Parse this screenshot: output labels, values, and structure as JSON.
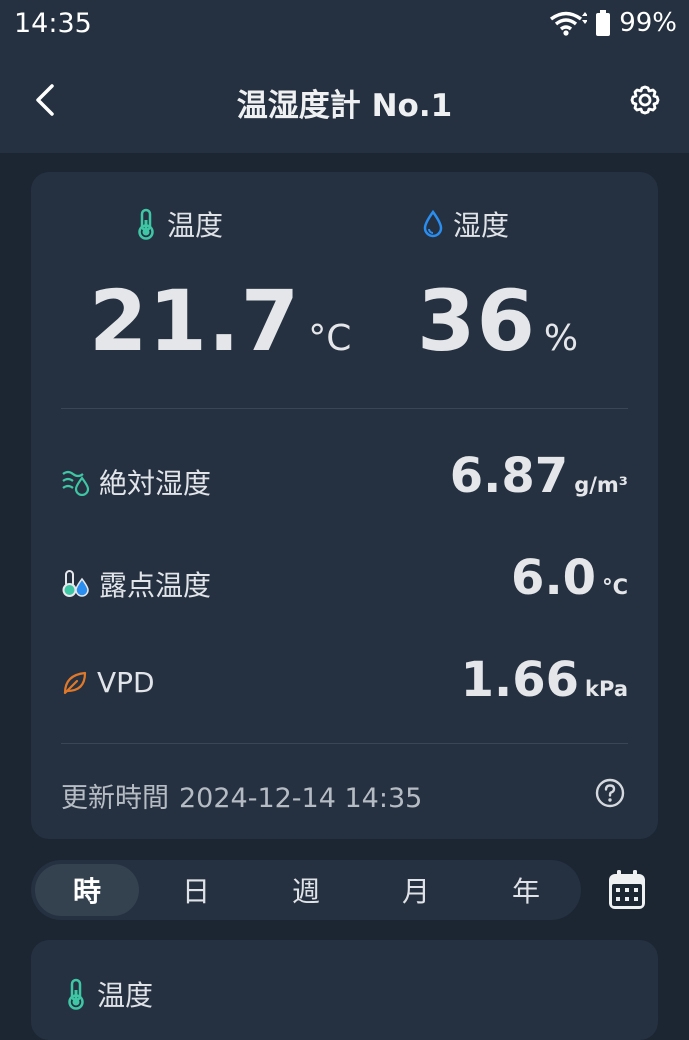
{
  "status": {
    "time": "14:35",
    "battery": "99%"
  },
  "appbar": {
    "title": "温湿度計 No.1"
  },
  "current": {
    "temperature": {
      "label": "温度",
      "value": "21.7",
      "unit": "°C"
    },
    "humidity": {
      "label": "湿度",
      "value": "36",
      "unit": "%"
    },
    "rows": [
      {
        "label": "絶対湿度",
        "value": "6.87",
        "unit": "g/m³"
      },
      {
        "label": "露点温度",
        "value": "6.0",
        "unit": "°C"
      },
      {
        "label": "VPD",
        "value": "1.66",
        "unit": "kPa"
      }
    ],
    "updated_label": "更新時間",
    "updated_value": "2024-12-14 14:35"
  },
  "range_tabs": [
    "時",
    "日",
    "週",
    "月",
    "年"
  ],
  "active_tab": "時",
  "chart_card": {
    "label": "温度"
  },
  "colors": {
    "temp": "#3fc6a5",
    "humidity": "#2a8df0",
    "vpd": "#e0782a"
  }
}
